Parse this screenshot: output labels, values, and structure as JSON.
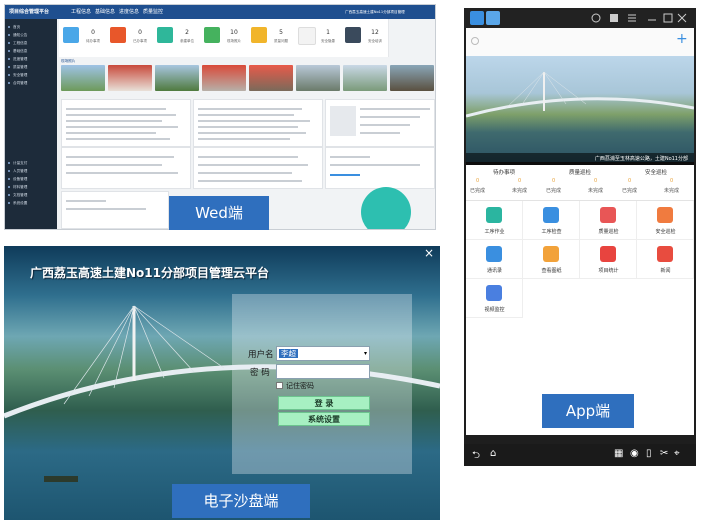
{
  "web": {
    "title": "项目综合管理平台",
    "top_links": [
      "工程信息",
      "基础信息",
      "进度信息",
      "质量监控"
    ],
    "user_text": "广西荔玉高速土建No11分部项目管理",
    "stats": [
      {
        "value": "0",
        "label": "待办事项",
        "color": "#4aa7e8"
      },
      {
        "value": "0",
        "label": "已办事项",
        "color": "#e8572a"
      },
      {
        "value": "2",
        "label": "参建单位",
        "color": "#2fb79a"
      },
      {
        "value": "10",
        "label": "现场照片",
        "color": "#45b25e"
      },
      {
        "value": "5",
        "label": "质量问题",
        "color": "#f1b52b"
      },
      {
        "value": "1",
        "label": "安全隐患",
        "color": "#f3f3f3"
      },
      {
        "value": "12",
        "label": "安全培训",
        "color": "#3a4a5c"
      }
    ],
    "sidebar_items": [
      "首页",
      "通知公告",
      "工程信息",
      "基础信息",
      "进度管理",
      "质量管理",
      "安全管理",
      "合同管理",
      "计量支付",
      "人员管理",
      "设备管理",
      "材料管理",
      "文档管理",
      "系统设置"
    ],
    "photo_section": "现场照片"
  },
  "labels": {
    "web": "Wed端",
    "app": "App端",
    "sandbox": "电子沙盘端"
  },
  "app": {
    "banner_caption": "广西荔浦至玉林高速公路，土建No11分部",
    "summary": [
      {
        "title": "待办事项",
        "left": "已完成",
        "right": "未完成",
        "lv": "0",
        "rv": "0"
      },
      {
        "title": "质量巡检",
        "left": "已完成",
        "right": "未完成",
        "lv": "0",
        "rv": "0"
      },
      {
        "title": "安全巡检",
        "left": "已完成",
        "right": "未完成",
        "lv": "0",
        "rv": "0"
      }
    ],
    "tiles": [
      {
        "label": "工序作业",
        "color": "#2bb5a0",
        "icon": "clock-icon"
      },
      {
        "label": "工序检查",
        "color": "#3a8fe0",
        "icon": "check-icon"
      },
      {
        "label": "质量巡检",
        "color": "#e85656",
        "icon": "star-icon"
      },
      {
        "label": "安全巡检",
        "color": "#f07b3f",
        "icon": "shield-icon"
      },
      {
        "label": "通讯录",
        "color": "#3a8fe0",
        "icon": "phone-icon"
      },
      {
        "label": "查看图纸",
        "color": "#f2a23a",
        "icon": "image-icon"
      },
      {
        "label": "项目统计",
        "color": "#e8443f",
        "icon": "chart-icon"
      },
      {
        "label": "新闻",
        "color": "#e84c3f",
        "icon": "news-icon"
      },
      {
        "label": "视频监控",
        "color": "#4a7fe0",
        "icon": "video-icon"
      }
    ]
  },
  "sandbox": {
    "title": "广西荔玉高速土建No11分部项目管理云平台",
    "username_label": "用户名",
    "username_value": "李超",
    "password_label": "密  码",
    "remember_label": "记住密码",
    "login_label": "登    录",
    "settings_label": "系统设置",
    "close_icon": "×"
  }
}
